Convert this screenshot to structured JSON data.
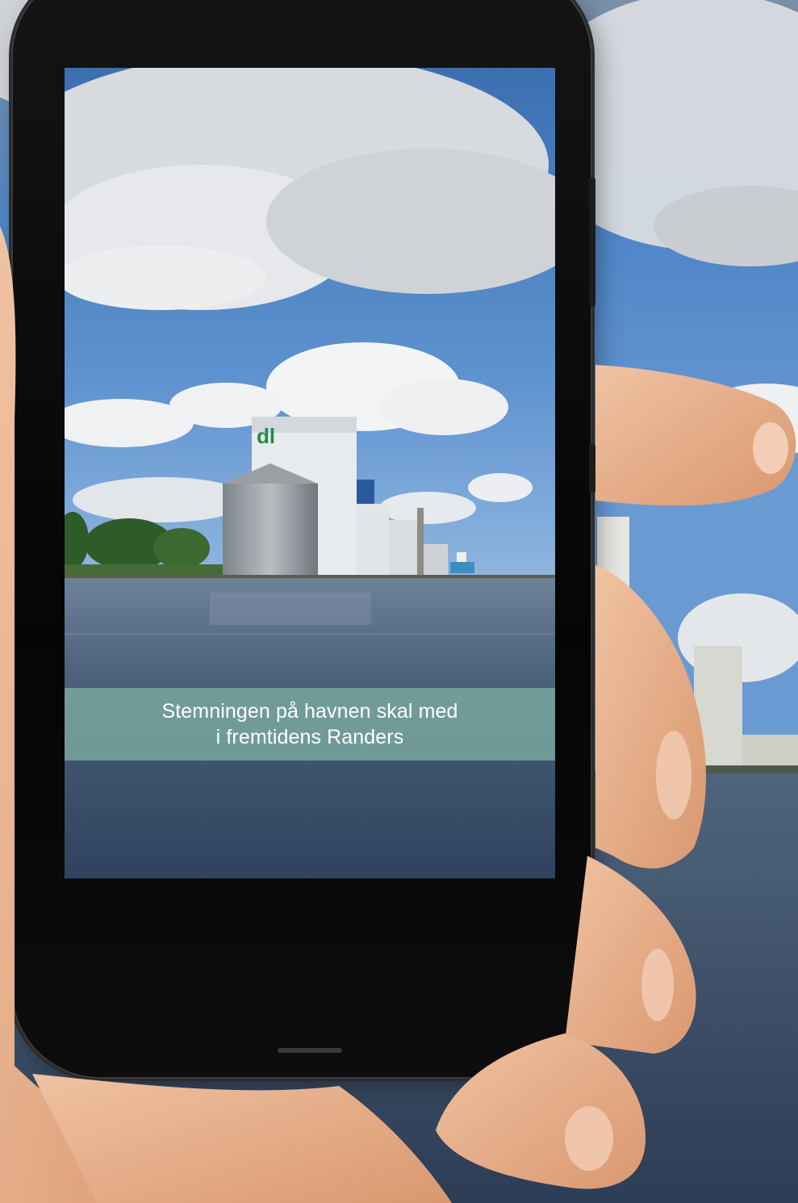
{
  "scene": {
    "description_icon": "photo-of-harbor",
    "colors": {
      "sky": "#4f86c9",
      "water": "#3a4f6a",
      "cloud": "#e7e9ec",
      "caption_band": "#7aaaa0",
      "skin": "#e9b392",
      "phone_body": "#0a0a0a"
    }
  },
  "screen": {
    "caption": {
      "line1": "Stemningen på havnen skal med",
      "line2": "i fremtidens Randers"
    }
  }
}
